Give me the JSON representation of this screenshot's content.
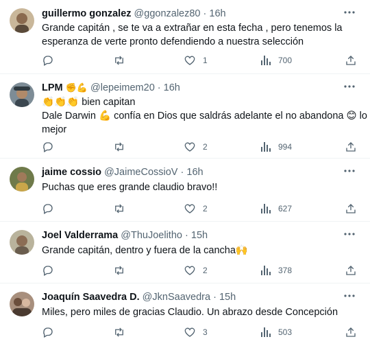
{
  "tweets": [
    {
      "name": "guillermo gonzalez",
      "handle": "@ggonzalez80",
      "sep": "·",
      "time": "16h",
      "name_emoji": "",
      "lines": [
        "Grande capitán , se te va a extrañar en esta fecha , pero tenemos la",
        "esperanza de verte pronto defendiendo a nuestra selección"
      ],
      "likes": "1",
      "views": "700"
    },
    {
      "name": "LPM",
      "handle": "@lepeimem20",
      "sep": "·",
      "time": "16h",
      "name_emoji": "✊💪",
      "lines": [
        "👏👏👏 bien capitan",
        "Dale Darwin 💪 confía en Dios que saldrás adelante el no abandona 😊 lo",
        "mejor"
      ],
      "likes": "2",
      "views": "994"
    },
    {
      "name": "jaime cossio",
      "handle": "@JaimeCossioV",
      "sep": "·",
      "time": "16h",
      "name_emoji": "",
      "lines": [
        "Puchas que eres grande claudio bravo!!"
      ],
      "likes": "2",
      "views": "627"
    },
    {
      "name": "Joel Valderrama",
      "handle": "@ThuJoelitho",
      "sep": "·",
      "time": "15h",
      "name_emoji": "",
      "lines": [
        "Grande capitán, dentro y fuera de la cancha🙌"
      ],
      "likes": "2",
      "views": "378"
    },
    {
      "name": "Joaquín Saavedra D.",
      "handle": "@JknSaavedra",
      "sep": "·",
      "time": "15h",
      "name_emoji": "",
      "lines": [
        "Miles, pero miles de gracias Claudio. Un abrazo desde Concepción"
      ],
      "likes": "3",
      "views": "503"
    }
  ],
  "icons": {
    "reply": "reply-icon",
    "retweet": "retweet-icon",
    "like": "heart-icon",
    "views": "views-icon",
    "share": "share-icon",
    "more": "more-icon"
  },
  "colors": {
    "text": "#0f1419",
    "muted": "#536471",
    "divider": "#eff3f4"
  }
}
